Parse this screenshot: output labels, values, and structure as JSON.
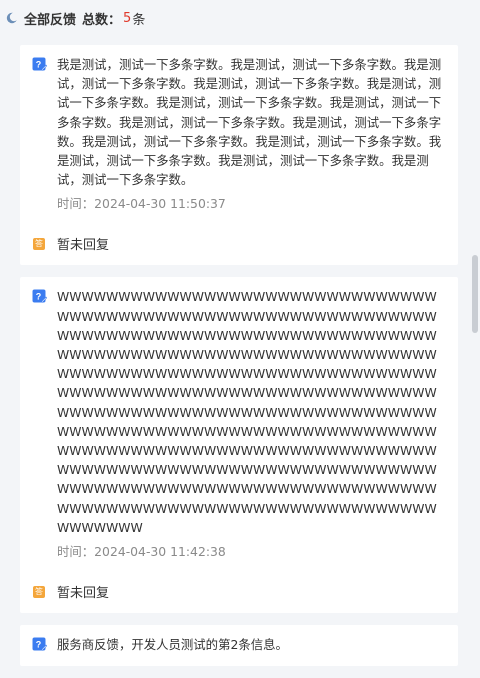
{
  "header": {
    "title": "全部反馈",
    "count_label": "总数：",
    "count": "5",
    "unit": "条"
  },
  "feedback": [
    {
      "message": "我是测试，测试一下多条字数。我是测试，测试一下多条字数。我是测试，测试一下多条字数。我是测试，测试一下多条字数。我是测试，测试一下多条字数。我是测试，测试一下多条字数。我是测试，测试一下多条字数。我是测试，测试一下多条字数。我是测试，测试一下多条字数。我是测试，测试一下多条字数。我是测试，测试一下多条字数。我是测试，测试一下多条字数。我是测试，测试一下多条字数。我是测试，测试一下多条字数。",
      "time": "时间：2024-04-30 11:50:37",
      "reply": "暂未回复"
    },
    {
      "message": "WWWWWWWWWWWWWWWWWWWWWWWWWWWWWWWWWWWWWWWWWWWWWWWWWWWWWWWWWWWWWWWWWWWWWWWWWWWWWWWWWWWWWWWWWWWWWWWWWWWWWWWWWWWWWWWWWWWWWWWWWWWWWWWWWWWWWWWWWWWWWWWWWWWWWWWWWWWWWWWWWWWWWWWWWWWWWWWWWWWWWWWWWWWWWWWWWWWWWWWWWWWWWWWWWWWWWWWWWWWWWWWWWWWWWWWWWWWWWWWWWWWWWWWWWWWWWWWWWWWWWWWWWWWWWWWWWWWWWWWWWWWWWWWWWWWWWWWWWWWWWWWWWWWWWWWWWWWWWWWWWWWWWWWWWWWWWWWWWWWWWWWWWWWWWWWWWWWWWWWWWWWWWWWWWWWWWWWWWWW",
      "time": "时间：2024-04-30 11:42:38",
      "reply": "暂未回复"
    },
    {
      "message": "服务商反馈，开发人员测试的第2条信息。",
      "time": "",
      "reply": ""
    }
  ],
  "icons": {
    "question": "feedback-question-icon",
    "answer": "reply-answer-icon",
    "answer_glyph": "答"
  },
  "colors": {
    "accent_count": "#e0392b",
    "question_icon": "#3b7cf0",
    "answer_icon": "#f4a63b"
  }
}
